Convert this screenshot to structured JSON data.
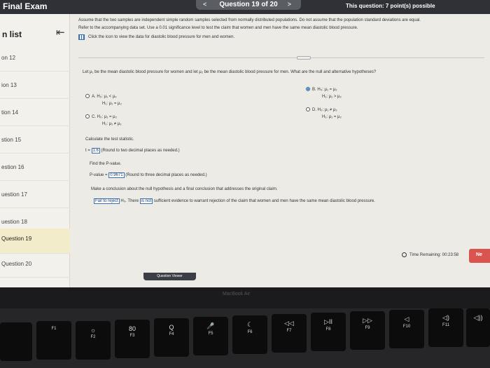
{
  "topbar": {
    "title": "Final Exam",
    "question_nav": "Question 19 of 20",
    "prev_arrow": "<",
    "next_arrow": ">",
    "points": "This question: 7 point(s) possible"
  },
  "sidebar": {
    "title": "n list",
    "collapse_icon": "collapse-arrow-icon",
    "items": [
      "on 12",
      "ion 13",
      "tion 14",
      "stion 15",
      "estion 16",
      "uestion 17",
      "uestion 18",
      "Question 19",
      "Question 20"
    ],
    "active_index": 7
  },
  "problem": {
    "intro_line1": "Assume that the two samples are independent simple random samples selected from normally distributed populations. Do not assume that the population standard deviations are equal.",
    "intro_line2": "Refer to the accompanying data set. Use a 0.01 significance level to test the claim that women and men have the same mean diastolic blood pressure.",
    "data_link": "Click the icon to view the data for diastolic blood pressure for men and women.",
    "hypothesis_prompt": "Let μ₁ be the mean diastolic blood pressure for women and let μ₂ be the mean diastolic blood pressure for men. What are the null and alternative hypotheses?",
    "options": {
      "a": {
        "h0": "A.  H₀: μ₁ < μ₂",
        "h1": "H₁: μ₁ = μ₂"
      },
      "b": {
        "h0": "B.  H₀: μ₁ = μ₂",
        "h1": "H₁: μ₁ > μ₂"
      },
      "c": {
        "h0": "C.  H₀: μ₁ = μ₂",
        "h1": "H₁: μ₁ ≠ μ₂"
      },
      "d": {
        "h0": "D.  H₀: μ₁ ≠ μ₂",
        "h1": "H₁: μ₁ = μ₂"
      }
    },
    "selected_option": "B",
    "calc_label": "Calculate the test statistic.",
    "t_prefix": "t =",
    "t_value": "1.6",
    "t_hint": "(Round to two decimal places as needed.)",
    "pvalue_label": "Find the P-value.",
    "pvalue_prefix": "P-value =",
    "pvalue_value": "0.9671",
    "pvalue_hint": "(Round to three decimal places as needed.)",
    "conclusion_label": "Make a conclusion about the null hypothesis and a final conclusion that addresses the original claim.",
    "conclusion_sel1": "Fail to reject",
    "conclusion_mid": "H₀. There",
    "conclusion_sel2": "is not",
    "conclusion_tail": "sufficient evidence to warrant rejection of the claim that women and men have the same mean diastolic blood pressure."
  },
  "timer": {
    "label": "Time Remaining: 00:23:58"
  },
  "next_button": "Ne",
  "question_viewer": "Question Viewer",
  "bezel_brand": "MacBook Air",
  "keys": [
    {
      "glyph": "",
      "fn": "F1"
    },
    {
      "glyph": "☼",
      "fn": "F2"
    },
    {
      "glyph": "80",
      "fn": "F3"
    },
    {
      "glyph": "Q",
      "fn": "F4"
    },
    {
      "glyph": "🎤",
      "fn": "F5"
    },
    {
      "glyph": "☾",
      "fn": "F6"
    },
    {
      "glyph": "◁◁",
      "fn": "F7"
    },
    {
      "glyph": "▷II",
      "fn": "F8"
    },
    {
      "glyph": "▷▷",
      "fn": "F9"
    },
    {
      "glyph": "◁",
      "fn": "F10"
    },
    {
      "glyph": "◁)",
      "fn": "F11"
    },
    {
      "glyph": "◁))",
      "fn": ""
    }
  ]
}
